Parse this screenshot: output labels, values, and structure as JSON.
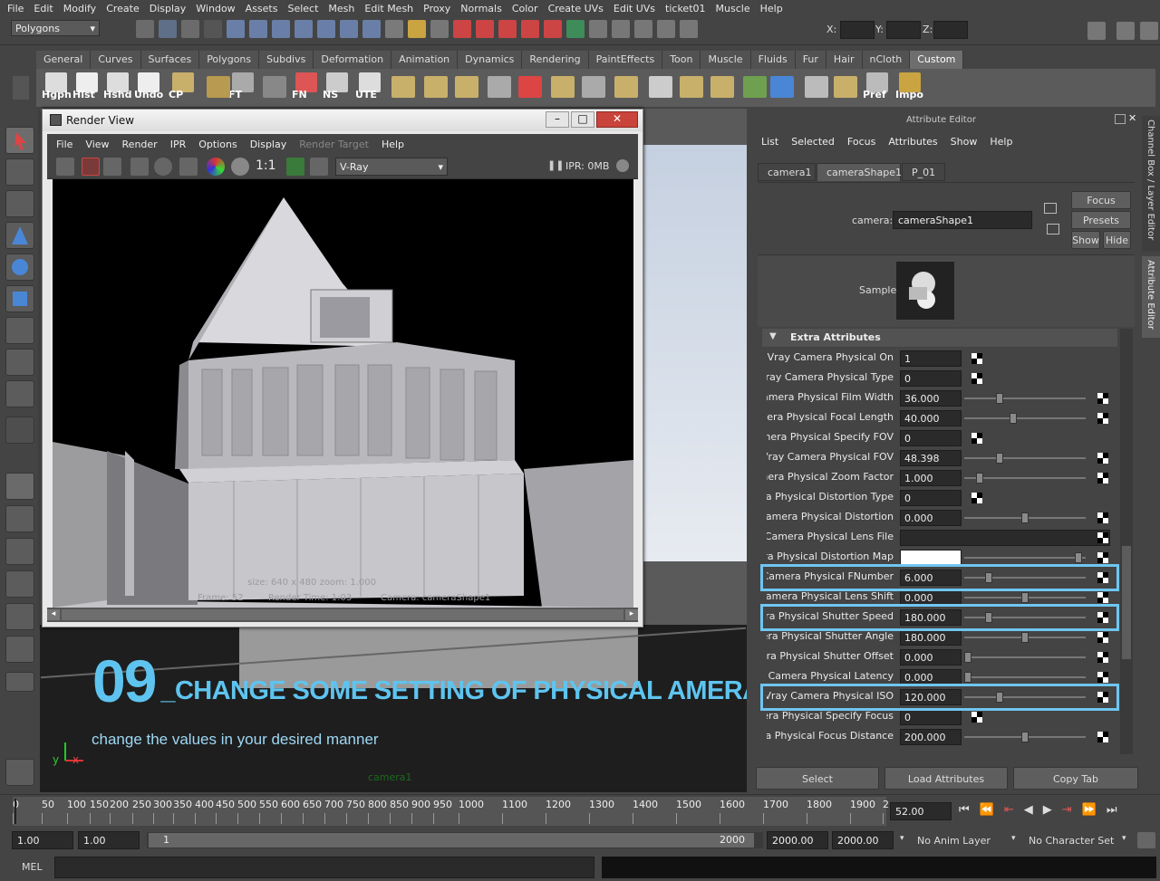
{
  "menubar": [
    "File",
    "Edit",
    "Modify",
    "Create",
    "Display",
    "Window",
    "Assets",
    "Select",
    "Mesh",
    "Edit Mesh",
    "Proxy",
    "Normals",
    "Color",
    "Create UVs",
    "Edit UVs",
    "ticket01",
    "Muscle",
    "Help"
  ],
  "status": {
    "mode": "Polygons",
    "x_label": "X:",
    "y_label": "Y:",
    "z_label": "Z:"
  },
  "shelf_tabs": [
    "General",
    "Curves",
    "Surfaces",
    "Polygons",
    "Subdivs",
    "Deformation",
    "Animation",
    "Dynamics",
    "Rendering",
    "PaintEffects",
    "Toon",
    "Muscle",
    "Fluids",
    "Fur",
    "Hair",
    "nCloth",
    "Custom"
  ],
  "shelf_labels": [
    "Hgph",
    "Hist",
    "Hshd",
    "Undo",
    "CP",
    "FT",
    "FN",
    "NS",
    "UTE",
    "Pref",
    "Impo"
  ],
  "render_view": {
    "title": "Render View",
    "menu": [
      "File",
      "View",
      "Render",
      "IPR",
      "Options",
      "Display",
      "Render Target",
      "Help"
    ],
    "ratio": "1:1",
    "renderer": "V-Ray",
    "ipr": "IPR: 0MB",
    "info1": "size: 640 x 480 zoom: 1.000",
    "info2": "Frame: 52",
    "info3": "Render Time: 1:03",
    "info4": "Camera: cameraShape1"
  },
  "attribute_editor": {
    "title": "Attribute Editor",
    "menu": [
      "List",
      "Selected",
      "Focus",
      "Attributes",
      "Show",
      "Help"
    ],
    "tabs": [
      "camera1",
      "cameraShape1",
      "P_01"
    ],
    "camera_label": "camera:",
    "camera_value": "cameraShape1",
    "btn_focus": "Focus",
    "btn_presets": "Presets",
    "btn_show": "Show",
    "btn_hide": "Hide",
    "sample_label": "Sample",
    "section": "Extra Attributes",
    "rows": [
      {
        "label": "Vray Camera Physical On",
        "value": "1",
        "type": "bool",
        "slider": null
      },
      {
        "label": "Vray Camera Physical Type",
        "value": "0",
        "type": "bool",
        "slider": null
      },
      {
        "label": "Vray Camera Physical Film Width",
        "value": "36.000",
        "type": "slider",
        "slider": 0.28
      },
      {
        "label": "Vray Camera Physical Focal Length",
        "value": "40.000",
        "type": "slider",
        "slider": 0.4
      },
      {
        "label": "Vray Camera Physical Specify FOV",
        "value": "0",
        "type": "bool",
        "slider": null
      },
      {
        "label": "Vray Camera Physical FOV",
        "value": "48.398",
        "type": "slider",
        "slider": 0.28
      },
      {
        "label": "Vray Camera Physical Zoom Factor",
        "value": "1.000",
        "type": "slider",
        "slider": 0.1
      },
      {
        "label": "Vray Camera Physical Distortion Type",
        "value": "0",
        "type": "bool",
        "slider": null
      },
      {
        "label": "Vray Camera Physical Distortion",
        "value": "0.000",
        "type": "slider",
        "slider": 0.5
      },
      {
        "label": "Vray Camera Physical Lens File",
        "value": "",
        "type": "file",
        "slider": null
      },
      {
        "label": "Vray Camera Physical Distortion Map",
        "value": "",
        "type": "color",
        "slider": 0.97
      },
      {
        "label": "Vray Camera Physical FNumber",
        "value": "6.000",
        "type": "slider",
        "slider": 0.18
      },
      {
        "label": "Vray Camera Physical Lens Shift",
        "value": "0.000",
        "type": "slider",
        "slider": 0.5
      },
      {
        "label": "Vray Camera Physical Shutter Speed",
        "value": "180.000",
        "type": "slider",
        "slider": 0.18
      },
      {
        "label": "Vray Camera Physical Shutter Angle",
        "value": "180.000",
        "type": "slider",
        "slider": 0.5
      },
      {
        "label": "Vray Camera Physical Shutter Offset",
        "value": "0.000",
        "type": "slider",
        "slider": 0.0
      },
      {
        "label": "Vray Camera Physical Latency",
        "value": "0.000",
        "type": "slider",
        "slider": 0.0
      },
      {
        "label": "Vray Camera Physical ISO",
        "value": "120.000",
        "type": "slider",
        "slider": 0.28
      },
      {
        "label": "Vray Camera Physical Specify Focus",
        "value": "0",
        "type": "bool",
        "slider": null
      },
      {
        "label": "Vray Camera Physical Focus Distance",
        "value": "200.000",
        "type": "slider",
        "slider": 0.5
      }
    ],
    "btn_select": "Select",
    "btn_load": "Load Attributes",
    "btn_copy": "Copy Tab"
  },
  "side_tabs": [
    "Channel Box / Layer Editor",
    "Attribute Editor"
  ],
  "viewport": {
    "step": "09",
    "heading": "_CHANGE SOME SETTING OF PHYSICAL AMERA",
    "subheading": "change the values in your desired manner",
    "camera": "camera1",
    "axis_x": "x",
    "axis_y": "y"
  },
  "timeline": {
    "ticks": [
      "0",
      "50",
      "100",
      "150",
      "200",
      "250",
      "300",
      "350",
      "400",
      "450",
      "500",
      "550",
      "600",
      "650",
      "700",
      "750",
      "800",
      "850",
      "900",
      "950",
      "1000",
      "1100",
      "1200",
      "1300",
      "1400",
      "1500",
      "1600",
      "1700",
      "1800",
      "1900",
      "2"
    ],
    "current": "52.00"
  },
  "range": {
    "start": "1.00",
    "start2": "1.00",
    "slider_start": "1",
    "slider_end": "2000",
    "end1": "2000.00",
    "end2": "2000.00",
    "anim_layer": "No Anim Layer",
    "char_set": "No Character Set"
  },
  "mel": "MEL",
  "colors": {
    "highlight": "#6fc6f1",
    "heading": "#5ec4ef"
  }
}
